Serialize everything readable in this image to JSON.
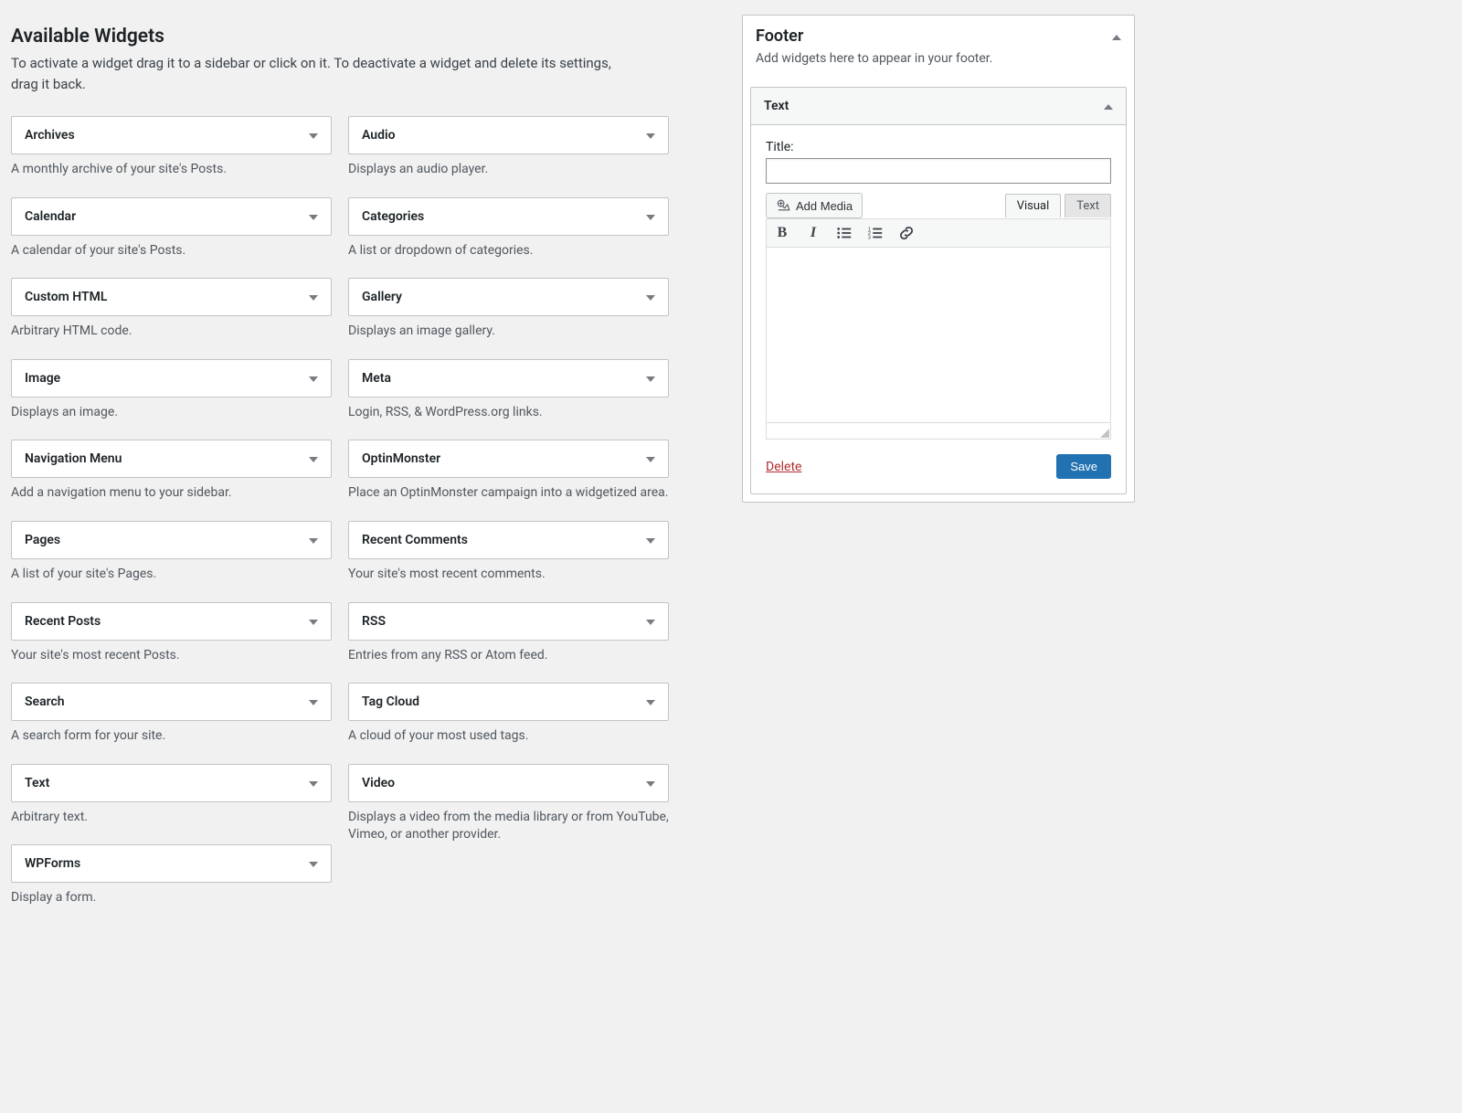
{
  "section": {
    "title": "Available Widgets",
    "description": "To activate a widget drag it to a sidebar or click on it. To deactivate a widget and delete its settings, drag it back."
  },
  "widgets": {
    "col1": [
      {
        "name": "Archives",
        "desc": "A monthly archive of your site's Posts."
      },
      {
        "name": "Calendar",
        "desc": "A calendar of your site's Posts."
      },
      {
        "name": "Custom HTML",
        "desc": "Arbitrary HTML code."
      },
      {
        "name": "Image",
        "desc": "Displays an image."
      },
      {
        "name": "Navigation Menu",
        "desc": "Add a navigation menu to your sidebar."
      },
      {
        "name": "Pages",
        "desc": "A list of your site's Pages."
      },
      {
        "name": "Recent Posts",
        "desc": "Your site's most recent Posts."
      },
      {
        "name": "Search",
        "desc": "A search form for your site."
      },
      {
        "name": "Text",
        "desc": "Arbitrary text."
      },
      {
        "name": "WPForms",
        "desc": "Display a form."
      }
    ],
    "col2": [
      {
        "name": "Audio",
        "desc": "Displays an audio player."
      },
      {
        "name": "Categories",
        "desc": "A list or dropdown of categories."
      },
      {
        "name": "Gallery",
        "desc": "Displays an image gallery."
      },
      {
        "name": "Meta",
        "desc": "Login, RSS, & WordPress.org links."
      },
      {
        "name": "OptinMonster",
        "desc": "Place an OptinMonster campaign into a wid­getized area."
      },
      {
        "name": "Recent Comments",
        "desc": "Your site's most recent comments."
      },
      {
        "name": "RSS",
        "desc": "Entries from any RSS or Atom feed."
      },
      {
        "name": "Tag Cloud",
        "desc": "A cloud of your most used tags."
      },
      {
        "name": "Video",
        "desc": "Displays a video from the media library or from YouTube, Vimeo, or another provider."
      }
    ]
  },
  "sidebar": {
    "title": "Footer",
    "description": "Add widgets here to appear in your footer.",
    "widget": {
      "name": "Text",
      "title_label": "Title:",
      "title_value": "",
      "add_media": "Add Media",
      "tab_visual": "Visual",
      "tab_text": "Text",
      "delete": "Delete",
      "save": "Save"
    }
  }
}
